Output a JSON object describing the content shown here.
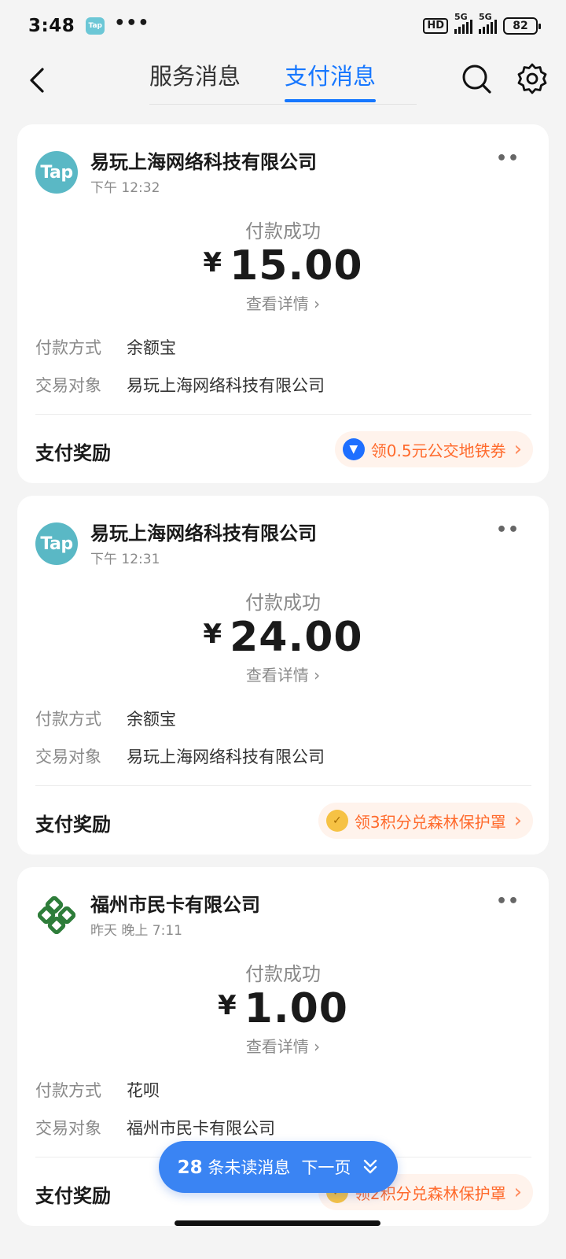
{
  "status_bar": {
    "time": "3:48",
    "app_icon": "Tap",
    "dots": "•••",
    "hd": "HD",
    "signal1": "5G",
    "signal2": "5G",
    "battery": "82"
  },
  "header": {
    "tabs": [
      {
        "label": "服务消息",
        "active": false
      },
      {
        "label": "支付消息",
        "active": true
      }
    ],
    "icons": [
      "back-icon",
      "search-icon",
      "gear-icon"
    ]
  },
  "cards": [
    {
      "merchant": "易玩上海网络科技有限公司",
      "logo_text": "Tap",
      "time": "下午 12:32",
      "more": "••",
      "status": "付款成功",
      "currency": "¥",
      "amount": "15.00",
      "detail": "查看详情",
      "rows": [
        {
          "label": "付款方式",
          "value": "余额宝"
        },
        {
          "label": "交易对象",
          "value": "易玩上海网络科技有限公司"
        }
      ],
      "reward_title": "支付奖励",
      "reward_text": "领0.5元公交地铁券",
      "reward_icon": "transit-coupon-icon"
    },
    {
      "merchant": "易玩上海网络科技有限公司",
      "logo_text": "Tap",
      "time": "下午 12:31",
      "more": "••",
      "status": "付款成功",
      "currency": "¥",
      "amount": "24.00",
      "detail": "查看详情",
      "rows": [
        {
          "label": "付款方式",
          "value": "余额宝"
        },
        {
          "label": "交易对象",
          "value": "易玩上海网络科技有限公司"
        }
      ],
      "reward_title": "支付奖励",
      "reward_text": "领3积分兑森林保护罩",
      "reward_icon": "points-icon"
    },
    {
      "merchant": "福州市民卡有限公司",
      "logo_text": "",
      "time": "昨天 晚上 7:11",
      "more": "••",
      "status": "付款成功",
      "currency": "¥",
      "amount": "1.00",
      "detail": "查看详情",
      "rows": [
        {
          "label": "付款方式",
          "value": "花呗"
        },
        {
          "label": "交易对象",
          "value": "福州市民卡有限公司"
        }
      ],
      "reward_title": "支付奖励",
      "reward_text": "领2积分兑森林保护罩",
      "reward_icon": "points-icon"
    }
  ],
  "unread": {
    "count": "28",
    "label": "条未读消息",
    "next": "下一页"
  },
  "colors": {
    "accent": "#1677ff",
    "reward": "#ff6a2c",
    "tap_logo": "#5ab8c5"
  }
}
